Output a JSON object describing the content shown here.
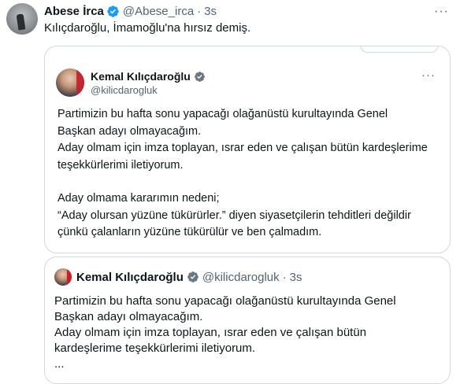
{
  "tweet": {
    "author_name": "Abese İrca",
    "handle": "@Abese_irca",
    "separator": "·",
    "time": "3s",
    "more": "···",
    "text": "Kılıçdaroğlu, İmamoğlu'na hırsız demiş."
  },
  "image_card": {
    "name": "Kemal Kılıçdaroğlu",
    "handle": "@kilicdarogluk",
    "more": "···",
    "paragraphs": [
      "Partimizin bu hafta sonu yapacağı olağanüstü kurultayında Genel",
      "Başkan adayı olmayacağım.",
      "Aday olmam için imza toplayan, ısrar eden ve çalışan bütün kardeşlerime",
      "teşekkürlerimi iletiyorum.",
      "",
      "Aday olmama kararımın nedeni;",
      "“Aday olursan yüzüne tükürürler.” diyen siyasetçilerin tehditleri değildir",
      "çünkü çalanların yüzüne tükürülür ve ben çalmadım."
    ]
  },
  "quote": {
    "name": "Kemal Kılıçdaroğlu",
    "handle": "@kilicdarogluk",
    "separator": "·",
    "time": "3s",
    "lines": [
      "Partimizin bu hafta sonu yapacağı olağanüstü kurultayında Genel",
      "Başkan adayı olmayacağım.",
      "Aday olmam için imza toplayan, ısrar eden ve çalışan bütün",
      "kardeşlerime teşekkürlerimi iletiyorum.",
      "..."
    ]
  },
  "colors": {
    "text": "#0f1419",
    "secondary": "#536471",
    "border": "#cfd9de",
    "verified": "#1d9bf0"
  },
  "icons": {
    "verified": "verified-badge-icon",
    "more": "more-options-icon"
  }
}
